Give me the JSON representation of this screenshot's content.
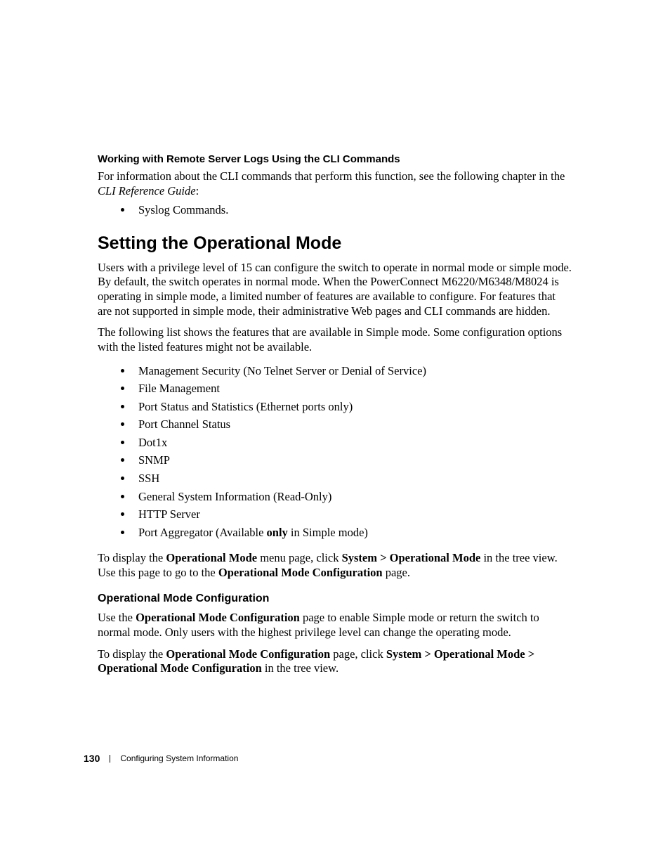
{
  "subhead1": "Working with Remote Server Logs Using the CLI Commands",
  "intro_para": "For information about the CLI commands that perform this function, see the following chapter in the ",
  "intro_italic": "CLI Reference Guide",
  "intro_colon": ":",
  "syslog_item": "Syslog Commands.",
  "section_title": "Setting the Operational Mode",
  "para1": "Users with a privilege level of 15 can configure the switch to operate in normal mode or simple mode. By default, the switch operates in normal mode. When the PowerConnect M6220/M6348/M8024 is operating in simple mode, a limited number of features are available to configure. For features that are not supported in simple mode, their administrative Web pages and CLI commands are hidden.",
  "para2": "The following list shows the features that are available in Simple mode. Some configuration options with the listed features might not be available.",
  "features": [
    "Management Security (No Telnet Server or Denial of Service)",
    "File Management",
    "Port Status and Statistics (Ethernet ports only)",
    "Port Channel Status",
    "Dot1x",
    "SNMP",
    "SSH",
    "General System Information (Read-Only)",
    "HTTP Server"
  ],
  "feature_last_pre": "Port Aggregator (Available ",
  "feature_last_bold": "only",
  "feature_last_post": " in Simple mode)",
  "para3_pre": "To display the ",
  "para3_b1": "Operational Mode",
  "para3_mid1": " menu page, click ",
  "para3_b2": "System > Operational Mode",
  "para3_mid2": " in the tree view. Use this page to go to the ",
  "para3_b3": "Operational Mode Configuration",
  "para3_post": " page.",
  "subsection": "Operational Mode Configuration",
  "para4_pre": "Use the ",
  "para4_b1": "Operational Mode Configuration",
  "para4_post": " page to enable Simple mode or return the switch to normal mode. Only users with the highest privilege level can change the operating mode.",
  "para5_pre": "To display the ",
  "para5_b1": "Operational Mode Configuration",
  "para5_mid": " page, click ",
  "para5_b2": "System > Operational Mode > Operational Mode Configuration",
  "para5_post": " in the tree view.",
  "footer": {
    "page": "130",
    "chapter": "Configuring System Information"
  }
}
